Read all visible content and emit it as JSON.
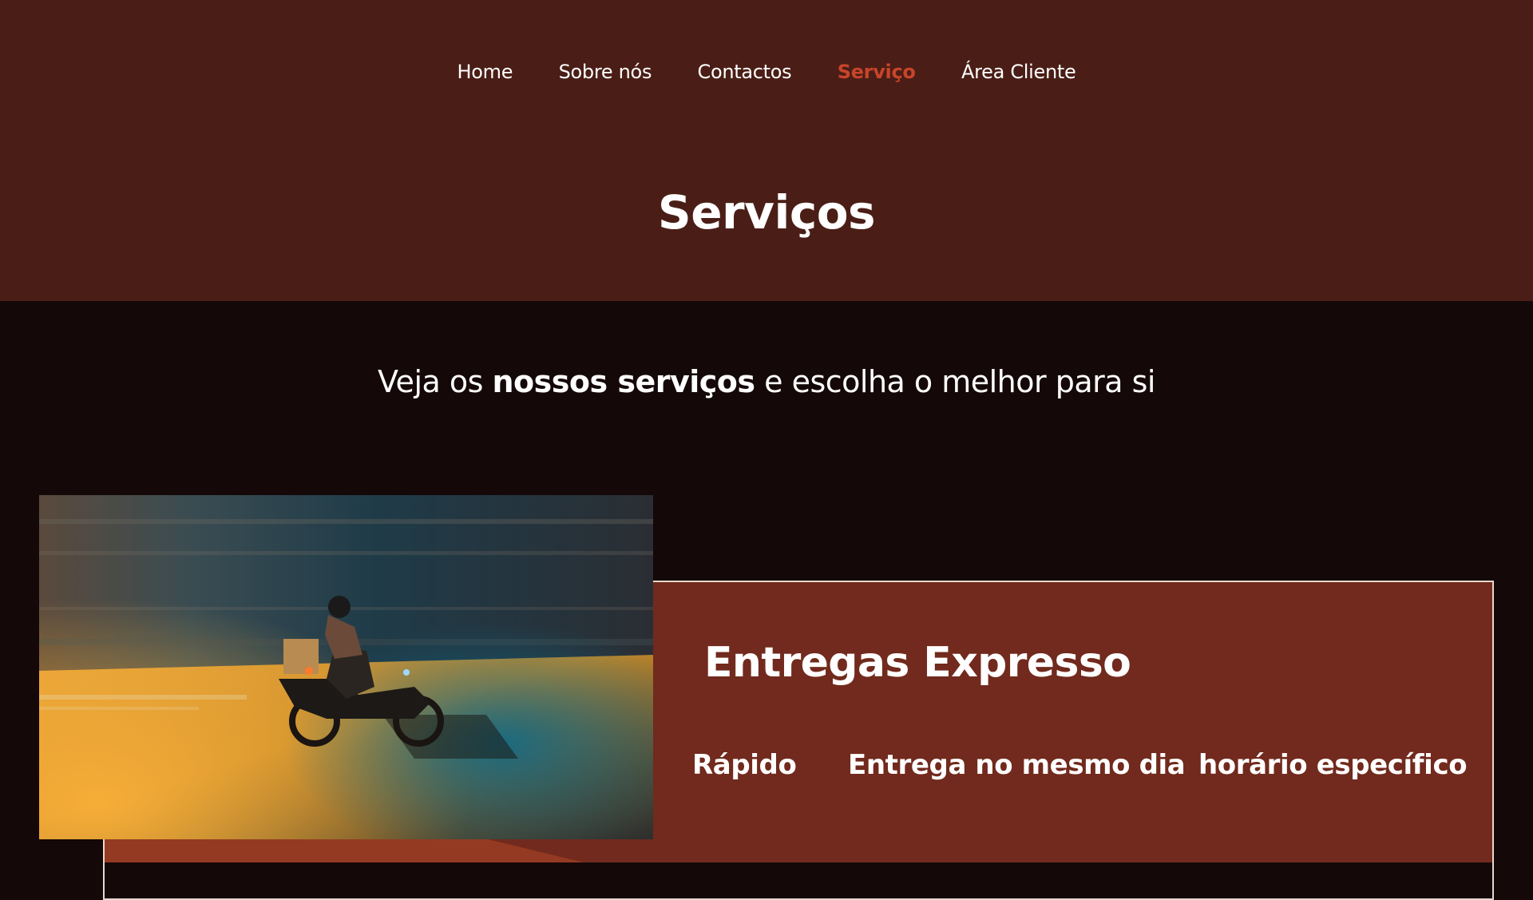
{
  "nav": {
    "items": [
      {
        "label": "Home",
        "active": false
      },
      {
        "label": "Sobre nós",
        "active": false
      },
      {
        "label": "Contactos",
        "active": false
      },
      {
        "label": "Serviço",
        "active": true
      },
      {
        "label": "Área Cliente",
        "active": false
      }
    ]
  },
  "header": {
    "title": "Serviços"
  },
  "intro": {
    "prefix": "Veja os ",
    "emphasis": "nossos serviços",
    "suffix": " e escolha o melhor para si"
  },
  "service": {
    "title": "Entregas Expresso",
    "image_icon": "motorcycle-delivery-photo",
    "features": [
      "Rápido",
      "Entrega no mesmo dia",
      "horário específico"
    ]
  },
  "colors": {
    "header_bg": "#4a1e16",
    "page_bg": "#140808",
    "accent": "#c8442a",
    "card_bg": "#712a1d"
  }
}
